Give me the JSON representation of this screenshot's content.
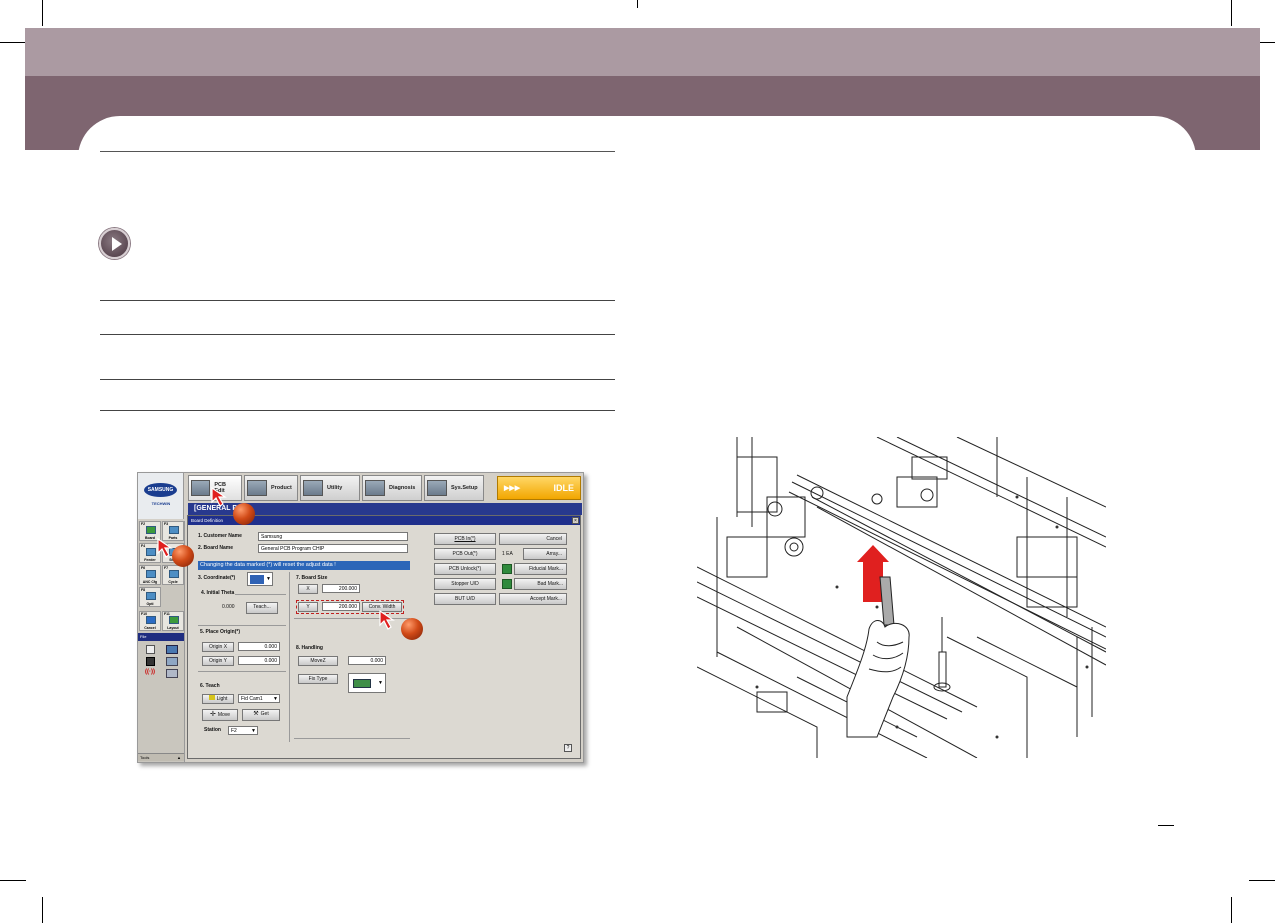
{
  "screenshot": {
    "logo_text": "SAMSUNG",
    "logo_sub": "TECHWIN",
    "tabs": [
      "PCB Edit",
      "Product",
      "Utility",
      "Diagnosis",
      "Sys.Setup"
    ],
    "status": "IDLE",
    "status_arrows": "▶▶▶",
    "title": "[GENERAL PCB]",
    "left_panel": {
      "fkeys": [
        {
          "key": "F2",
          "label": "Board"
        },
        {
          "key": "F3",
          "label": "Parts"
        },
        {
          "key": "F4",
          "label": "Feeder"
        },
        {
          "key": "F5",
          "label": "Step"
        },
        {
          "key": "F6",
          "label": "ANC Cfg"
        },
        {
          "key": "F7",
          "label": "Cycle"
        },
        {
          "key": "F8",
          "label": "Opti"
        },
        {
          "key": "F10",
          "label": "Cancel"
        },
        {
          "key": "F11",
          "label": "Layout"
        }
      ],
      "file_label": "File",
      "tools_label": "Tools"
    },
    "dialog": {
      "title": "Board Definition",
      "close": "×",
      "customer_name_label": "1. Customer Name",
      "customer_name_value": "Samsung",
      "board_name_label": "2. Board Name",
      "board_name_value": "General PCB Program CHIP",
      "warning": "Changing the data marked (*) will reset the adjust data !",
      "coordinate_label": "3. Coordinate(*)",
      "initial_theta_label": "4. Initial Theta",
      "initial_theta_value": "0.000",
      "teach_button": "Teach...",
      "place_origin_label": "5. Place Origin(*)",
      "origin_x_label": "Origin X",
      "origin_x_value": "0.000",
      "origin_y_label": "Origin Y",
      "origin_y_value": "0.000",
      "teach_label": "6. Teach",
      "light_button": "Light",
      "light_value": "Fid Cam1",
      "move_button": "Move",
      "get_button": "Get",
      "station_label": "Station",
      "station_value": "F2",
      "board_size_label": "7. Board Size",
      "x_label": "X",
      "x_value": "200.000",
      "y_label": "Y",
      "y_value": "200.000",
      "conv_width_button": "Conv. Width",
      "handling_label": "8. Handling",
      "movez_label": "MoveZ",
      "movez_value": "0.000",
      "fix_type_label": "Fix Type",
      "right_buttons": [
        "PCB In(*)",
        "PCB Out(*)",
        "PCB Unlock(*)",
        "Stopper U/D",
        "BUT U/D"
      ],
      "cancel_button": "Cancel",
      "array_qty": "1 EA",
      "array_button": "Array...",
      "fiducial_button": "Fiducial Mark...",
      "bad_mark_button": "Bad Mark...",
      "accept_mark_button": "Accept Mark...",
      "help": "?"
    }
  },
  "colors": {
    "band_light": "#ab9aa2",
    "band_dark": "#7e6570",
    "marker": "#d14a17",
    "arrow": "#e0201f",
    "idle": "#f2a600"
  }
}
